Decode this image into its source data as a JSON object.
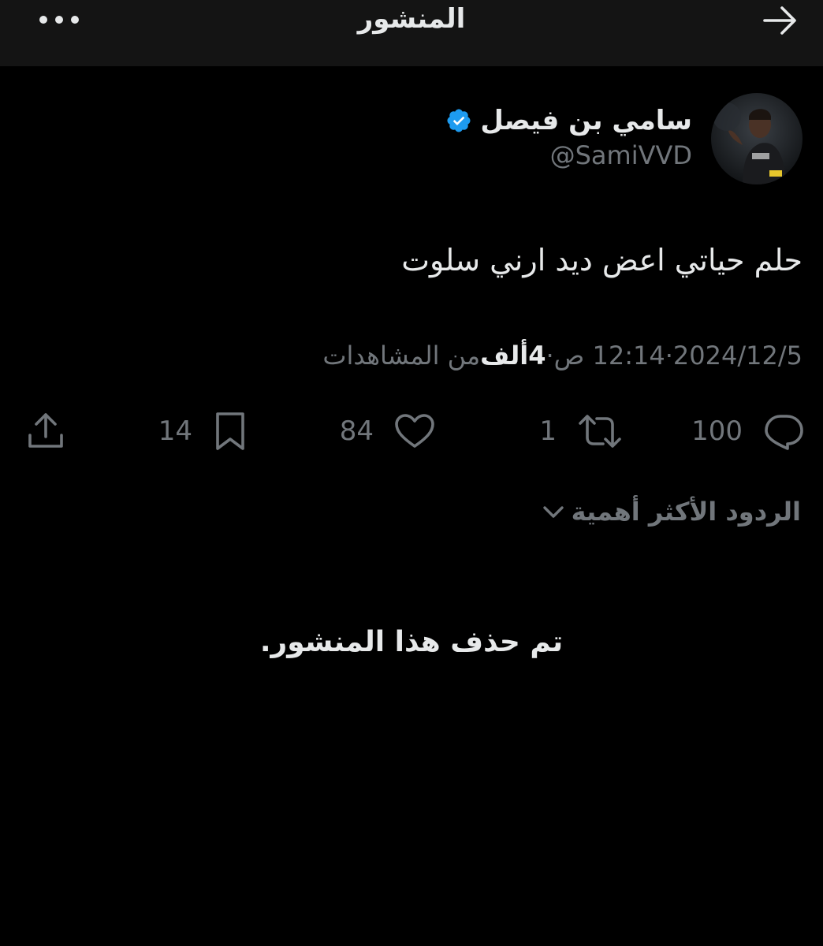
{
  "header": {
    "title": "المنشور"
  },
  "author": {
    "name": "سامي بن فيصل",
    "handle": "@SamiVVD",
    "verified_color": "#1d9bf0"
  },
  "tweet": {
    "text": "حلم حياتي اعض ديد ارني سلوت",
    "date": "2024/12/5",
    "time": "12:14 ص",
    "separator": " · ",
    "views_count": "4ألف",
    "views_label": " من المشاهدات"
  },
  "actions": {
    "replies": "100",
    "reposts": "1",
    "likes": "84",
    "bookmarks": "14"
  },
  "replies_sort": {
    "label": "الردود الأكثر أهمية"
  },
  "deleted_notice": "تم حذف هذا المنشور.",
  "icons": {
    "back": "arrow-right-icon",
    "more": "more-dots-icon",
    "verified": "verified-badge-icon",
    "reply": "reply-icon",
    "repost": "repost-icon",
    "like": "heart-icon",
    "bookmark": "bookmark-icon",
    "share": "share-icon",
    "chevron": "chevron-down-icon"
  },
  "colors": {
    "background": "#000000",
    "header_bg": "#141414",
    "text_primary": "#e7e9ea",
    "text_secondary": "#71767b",
    "accent": "#1d9bf0"
  }
}
